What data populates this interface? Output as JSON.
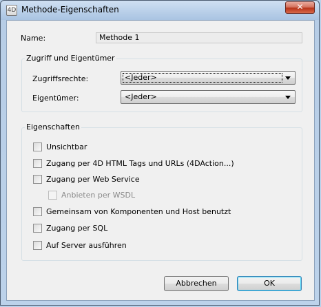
{
  "window": {
    "title": "Methode-Eigenschaften",
    "app_icon_text": "4D",
    "close_glyph": "✕"
  },
  "name_row": {
    "label": "Name:",
    "value": "Methode 1"
  },
  "access_group": {
    "legend": "Zugriff und Eigentümer",
    "access_rights": {
      "label": "Zugriffsrechte:",
      "selected": "<Jeder>"
    },
    "owner": {
      "label": "Eigentümer:",
      "selected": "<Jeder>"
    }
  },
  "properties_group": {
    "legend": "Eigenschaften",
    "options": [
      {
        "label": "Unsichtbar",
        "checked": false,
        "enabled": true
      },
      {
        "label": "Zugang per 4D HTML Tags und URLs (4DAction...)",
        "checked": false,
        "enabled": true
      },
      {
        "label": "Zugang per Web Service",
        "checked": false,
        "enabled": true
      },
      {
        "label": "Anbieten per WSDL",
        "checked": false,
        "enabled": false
      },
      {
        "label": "Gemeinsam von Komponenten und Host benutzt",
        "checked": false,
        "enabled": true
      },
      {
        "label": "Zugang per SQL",
        "checked": false,
        "enabled": true
      },
      {
        "label": "Auf Server ausführen",
        "checked": false,
        "enabled": true
      }
    ]
  },
  "buttons": {
    "cancel": "Abbrechen",
    "ok": "OK"
  },
  "colors": {
    "title_bar": "#a9c4e2",
    "client_bg": "#f0f0f0",
    "close_button": "#c8432b",
    "default_button_border": "#3c7fb1"
  }
}
